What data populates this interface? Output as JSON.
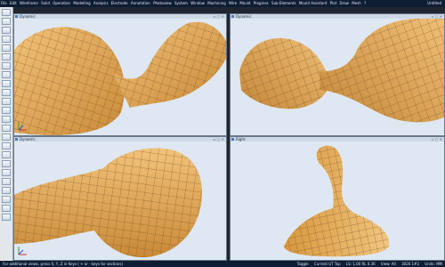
{
  "menu": {
    "items": [
      "File",
      "Edit",
      "Wireframe",
      "Solid",
      "Operation",
      "Modelling",
      "Analysis",
      "Electrode",
      "Annotation",
      "Photoview",
      "System",
      "Window",
      "Machining",
      "Wire",
      "Mould",
      "Progress",
      "Sub Elements",
      "Mould Assistant",
      "Plot",
      "Draw",
      "Mesh",
      "?"
    ],
    "document_title": "Untitled"
  },
  "viewports": {
    "top_left": {
      "title": "Dynamic"
    },
    "top_right": {
      "title": "Dynamic"
    },
    "bottom_left": {
      "title": "Dynamic"
    },
    "bottom_right": {
      "title": "Right"
    }
  },
  "status": {
    "message": "For additional views, press X, Y, Z in Keys ( + or - keys for sections)",
    "toggle_label": "Toggle",
    "work_plane": "Current UT Top",
    "layer": "LS: 1,00 RL 0.36",
    "view_label": "View: All",
    "view_value": "3026 1#3",
    "units": "Units: MM"
  },
  "colors": {
    "menubar": "#0f1d33",
    "viewport_bg": "#dfe8f2",
    "mesh_surface": "#e0a655",
    "mesh_lines": "#6e4a1e"
  }
}
